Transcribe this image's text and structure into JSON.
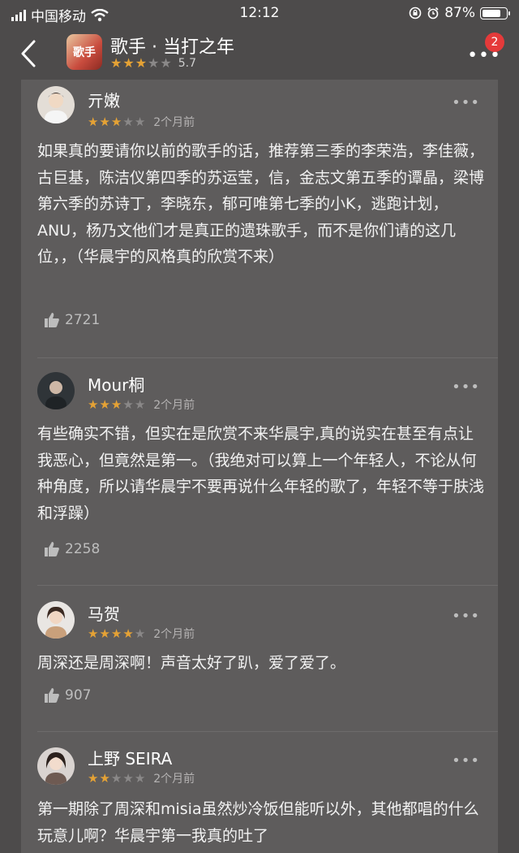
{
  "status_bar": {
    "carrier": "中国移动",
    "time": "12:12",
    "battery": "87%"
  },
  "header": {
    "title": "歌手 · 当打之年",
    "rating": "5.7",
    "rating_stars": 3,
    "app_icon_text": "歌手",
    "badge": "2"
  },
  "reviews": [
    {
      "user": "亓嫩",
      "stars": 3,
      "time": "2个月前",
      "text": "如果真的要请你以前的歌手的话，推荐第三季的李荣浩，李佳薇，古巨基，陈洁仪第四季的苏运莹，信，金志文第五季的谭晶，梁博第六季的苏诗丁，李晓东，郁可唯第七季的小K，逃跑计划，ANU，杨乃文他们才是真正的遗珠歌手，而不是你们请的这几位，，（华晨宇的风格真的欣赏不来）",
      "likes": "2721"
    },
    {
      "user": "Mour桐",
      "stars": 3,
      "time": "2个月前",
      "text": "有些确实不错，但实在是欣赏不来华晨宇,真的说实在甚至有点让我恶心，但竟然是第一。（我绝对可以算上一个年轻人，不论从何种角度，所以请华晨宇不要再说什么年轻的歌了，年轻不等于肤浅和浮躁）",
      "likes": "2258"
    },
    {
      "user": "马贺",
      "stars": 4,
      "time": "2个月前",
      "text": "周深还是周深啊！声音太好了趴，爱了爱了。",
      "likes": "907"
    },
    {
      "user": "上野 SEIRA",
      "stars": 2,
      "time": "2个月前",
      "text": "第一期除了周深和misia虽然炒冷饭但能听以外，其他都唱的什么玩意儿啊？华晨宇第一我真的吐了",
      "likes": ""
    }
  ],
  "colors": {
    "background": "#4d4b4b",
    "card": "#5e5c5c",
    "star_on": "#e5a235",
    "star_off": "#8a8888",
    "badge": "#e53a3a"
  }
}
